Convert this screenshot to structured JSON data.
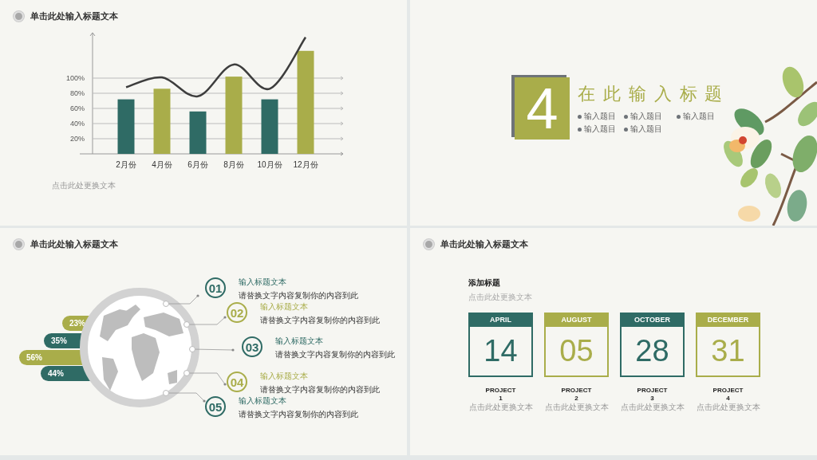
{
  "slides": [
    {
      "kind": "chart",
      "title": "单击此处输入标题文本",
      "chart_data": {
        "type": "bar",
        "grid": true,
        "ylim": [
          0,
          160
        ],
        "categories": [
          "2月份",
          "4月份",
          "6月份",
          "8月份",
          "10月份",
          "12月份"
        ],
        "yticks": [
          {
            "value": 20,
            "label": "20%"
          },
          {
            "value": 40,
            "label": "40%"
          },
          {
            "value": 60,
            "label": "60%"
          },
          {
            "value": 80,
            "label": "80%"
          },
          {
            "value": 100,
            "label": "100%"
          }
        ],
        "series": [
          {
            "type": "bar",
            "colors": [
              "#2f6b65",
              "#a9ad4a",
              "#2f6b65",
              "#a9ad4a",
              "#2f6b65",
              "#a9ad4a"
            ],
            "values": [
              72,
              86,
              56,
              102,
              72,
              136
            ]
          },
          {
            "type": "line",
            "color": "#3d3d3d",
            "values": [
              88,
              101,
              76,
              118,
              86,
              154
            ]
          }
        ]
      },
      "caption": "点击此处更换文本"
    },
    {
      "kind": "section",
      "number": "4",
      "title": "在此输入标题",
      "bullets": [
        "输入题目",
        "输入题目",
        "输入题目",
        "输入题目",
        "输入题目"
      ]
    },
    {
      "kind": "globe",
      "title": "单击此处输入标题文本",
      "bars": [
        {
          "label": "23%",
          "color": "#a9ad4a"
        },
        {
          "label": "35%",
          "color": "#2f6b65"
        },
        {
          "label": "56%",
          "color": "#a9ad4a"
        },
        {
          "label": "44%",
          "color": "#2f6b65"
        }
      ],
      "items": [
        {
          "number": "01",
          "title": "输入标题文本",
          "text": "请替换文字内容复制你的内容到此",
          "color": "#2f6b65"
        },
        {
          "number": "02",
          "title": "输入标题文本",
          "text": "请替换文字内容复制你的内容到此",
          "color": "#a9ad4a"
        },
        {
          "number": "03",
          "title": "输入标题文本",
          "text": "请替换文字内容复制你的内容到此",
          "color": "#2f6b65"
        },
        {
          "number": "04",
          "title": "输入标题文本",
          "text": "请替换文字内容复制你的内容到此",
          "color": "#a9ad4a"
        },
        {
          "number": "05",
          "title": "输入标题文本",
          "text": "请替换文字内容复制你的内容到此",
          "color": "#2f6b65"
        }
      ]
    },
    {
      "kind": "calendar",
      "title": "单击此处输入标题文本",
      "heading": "添加标题",
      "subheading": "点击此处更换文本",
      "cards": [
        {
          "month": "APRIL",
          "day": "14",
          "color": "#2f6b65",
          "project": "PROJECT",
          "project_number": "1",
          "text": "点击此处更换文本"
        },
        {
          "month": "AUGUST",
          "day": "05",
          "color": "#a9ad4a",
          "project": "PROJECT",
          "project_number": "2",
          "text": "点击此处更换文本"
        },
        {
          "month": "OCTOBER",
          "day": "28",
          "color": "#2f6b65",
          "project": "PROJECT",
          "project_number": "3",
          "text": "点击此处更换文本"
        },
        {
          "month": "DECEMBER",
          "day": "31",
          "color": "#a9ad4a",
          "project": "PROJECT",
          "project_number": "4",
          "text": "点击此处更换文本"
        }
      ]
    }
  ]
}
